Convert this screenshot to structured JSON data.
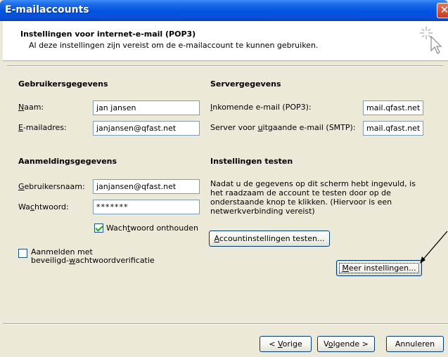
{
  "window": {
    "title": "E-mailaccounts",
    "close_glyph": "✕"
  },
  "header": {
    "title": "Instellingen voor internet-e-mail (POP3)",
    "subtitle": "Al deze instellingen zijn vereist om de e-mailaccount te kunnen gebruiken."
  },
  "user": {
    "section_title": "Gebruikersgegevens",
    "name_label": "Naam:",
    "name_value": "jan jansen",
    "email_label": "E-mailadres:",
    "email_value": "janjansen@qfast.net"
  },
  "server": {
    "section_title": "Servergegevens",
    "incoming_label": "Inkomende e-mail (POP3):",
    "incoming_value": "mail.qfast.net",
    "outgoing_label": "Server voor uitgaande e-mail (SMTP):",
    "outgoing_value": "mail.qfast.net"
  },
  "login": {
    "section_title": "Aanmeldingsgegevens",
    "username_label": "Gebruikersnaam:",
    "username_value": "janjansen@qfast.net",
    "password_label": "Wachtwoord:",
    "password_value": "*******",
    "remember_label": "Wachtwoord onthouden",
    "remember_checked": true,
    "spa_label_line1": "Aanmelden met",
    "spa_label_line2": "beveiligd-wachtwoordverificatie",
    "spa_checked": false
  },
  "test": {
    "section_title": "Instellingen testen",
    "description": "Nadat u de gegevens op dit scherm hebt ingevuld, is het raadzaam de account te testen door op de onderstaande knop te klikken. (Hiervoor is een netwerkverbinding vereist)",
    "test_button": "Accountinstellingen testen...",
    "more_button": "Meer instellingen..."
  },
  "footer": {
    "back_button": "< Vorige",
    "next_button": "Volgende >",
    "cancel_button": "Annuleren"
  },
  "colors": {
    "titlebar": "#0054E3",
    "dialog_bg": "#ECE9D8",
    "checkmark": "#21A121"
  }
}
